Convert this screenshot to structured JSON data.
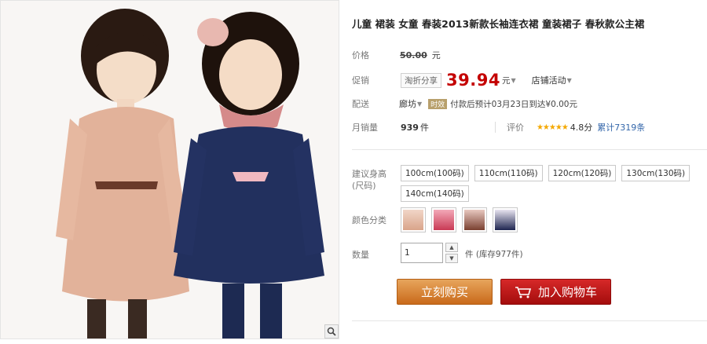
{
  "product": {
    "title": "儿童 裙装 女童 春装2013新款长袖连衣裙 童装裙子 春秋款公主裙",
    "price_label": "价格",
    "original_price": "50.00",
    "currency_unit": "元",
    "promo_label": "促销",
    "promo_tag": "淘折分享",
    "promo_price": "39.94",
    "promo_unit": "元",
    "shop_activity": "店铺活动",
    "shipping_label": "配送",
    "ship_from": "廊坊",
    "ship_badge": "时效",
    "ship_text": "付款后预计03月23日到达¥0.00元",
    "monthly_sales_label": "月销量",
    "monthly_sales": "939",
    "monthly_sales_unit": "件",
    "review_label": "评价",
    "stars": "★★★★★",
    "rating": "4.8分",
    "review_count": "累计7319条",
    "size_label": "建议身高(尺码)",
    "sizes": [
      "100cm(100码)",
      "110cm(110码)",
      "120cm(120码)",
      "130cm(130码)",
      "140cm(140码)"
    ],
    "color_label": "颜色分类",
    "quantity_label": "数量",
    "quantity_value": "1",
    "stock_text": "件 (库存977件)",
    "buy_now": "立刻购买",
    "add_to_cart": "加入购物车"
  },
  "colors": {
    "price_red": "#c40000",
    "buy_orange": "#d98030",
    "cart_red": "#c11a1a",
    "star_gold": "#f4a800"
  }
}
